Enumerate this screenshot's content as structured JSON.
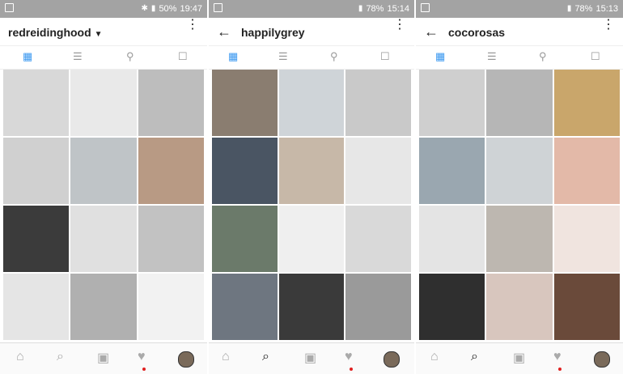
{
  "screens": [
    {
      "status": {
        "battery": "50%",
        "time": "19:47"
      },
      "username": "redreidinghood",
      "tabs": [
        "grid-icon",
        "list-icon",
        "location-icon",
        "tagged-icon"
      ],
      "bottom": [
        "home-icon",
        "search-icon",
        "camera-icon",
        "heart-icon",
        "profile-icon"
      ],
      "colors": [
        "#d8d8d8",
        "#e9e9e9",
        "#bdbdbd",
        "#d0d0d0",
        "#bfc4c7",
        "#b89a84",
        "#3b3b3b",
        "#e0e0e0",
        "#c2c2c2",
        "#e5e5e5",
        "#b0b0b0",
        "#f2f2f2"
      ]
    },
    {
      "status": {
        "battery": "78%",
        "time": "15:14"
      },
      "username": "happilygrey",
      "tabs": [
        "grid-icon",
        "list-icon",
        "location-icon",
        "tagged-icon"
      ],
      "bottom": [
        "home-icon",
        "search-icon",
        "camera-icon",
        "heart-icon",
        "profile-icon"
      ],
      "colors": [
        "#8a7d70",
        "#cfd4d8",
        "#c9c9c9",
        "#4a5563",
        "#c7b8a8",
        "#e7e7e7",
        "#6b7a6a",
        "#efefef",
        "#d9d9d9",
        "#6e7680",
        "#3a3a3a",
        "#9a9a9a"
      ]
    },
    {
      "status": {
        "battery": "78%",
        "time": "15:13"
      },
      "username": "cocorosas",
      "tabs": [
        "grid-icon",
        "list-icon",
        "location-icon",
        "tagged-icon"
      ],
      "bottom": [
        "home-icon",
        "search-icon",
        "camera-icon",
        "heart-icon",
        "profile-icon"
      ],
      "colors": [
        "#cfcfcf",
        "#b6b6b6",
        "#c9a66b",
        "#9aa7b0",
        "#cfd3d6",
        "#e3b9a8",
        "#e4e4e4",
        "#bdb7b0",
        "#f0e4df",
        "#2f2f2f",
        "#d8c6be",
        "#6a4a3a"
      ]
    }
  ]
}
